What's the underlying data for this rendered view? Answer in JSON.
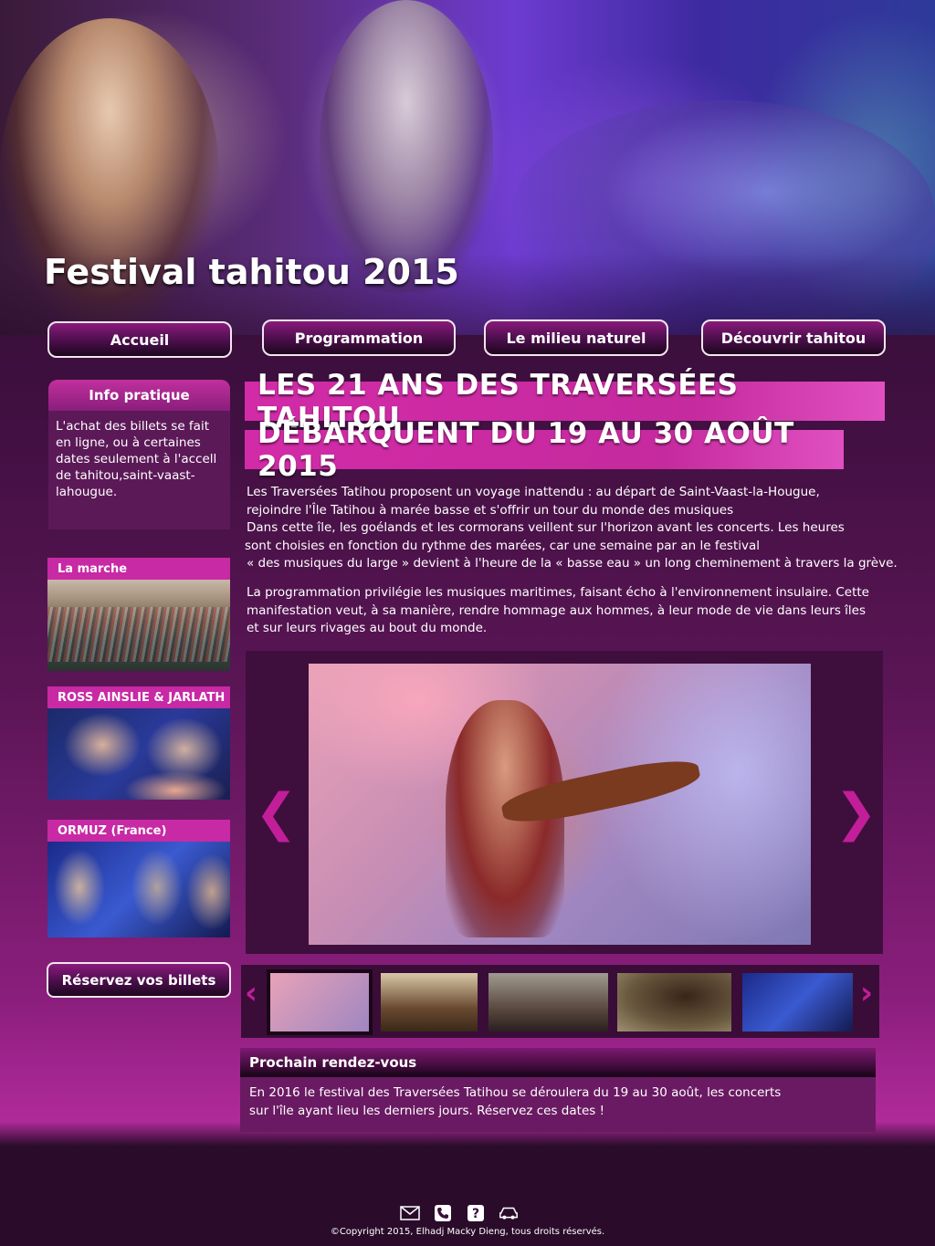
{
  "hero": {
    "title": "Festival tahitou 2015"
  },
  "nav": {
    "items": [
      {
        "label": "Accueil"
      },
      {
        "label": "Programmation"
      },
      {
        "label": "Le milieu naturel"
      },
      {
        "label": "Découvrir tahitou"
      }
    ]
  },
  "sidebar": {
    "info_title": "Info pratique",
    "info_text": "L'achat des billets se fait en ligne, ou à certaines dates seulement à l'accell de tahitou,saint-vaast-lahougue.",
    "cards": [
      {
        "caption": "La marche"
      },
      {
        "caption": "ROSS AINSLIE & JARLATH"
      },
      {
        "caption": "ORMUZ (France)"
      }
    ],
    "reserve_label": "Réservez vos billets"
  },
  "main": {
    "headline_1": "LES 21 ANS DES TRAVERSÉES TAHITOU",
    "headline_2": "DÉBARQUENT DU 19 AU 30 AOÛT 2015",
    "para_1_lines": [
      "Les Traversées Tatihou proposent un voyage inattendu : au départ de Saint-Vaast-la-Hougue,",
      " rejoindre l'Île Tatihou à marée basse et s'offrir un tour du monde des musiques",
      "Dans cette île, les goélands et les cormorans veillent sur l'horizon avant les concerts. Les heures",
      "sont choisies en fonction du rythme des marées, car une semaine par an le festival",
      "« des musiques du large » devient à  l'heure de la « basse eau » un long cheminement à travers la grève."
    ],
    "para_2_lines": [
      "La programmation privilégie les musiques maritimes, faisant écho à l'environnement insulaire. Cette",
      "manifestation veut, à sa manière, rendre hommage aux hommes, à leur mode de vie dans leurs îles",
      "et sur leurs rivages au bout du monde."
    ],
    "slider": {
      "prev": "❮",
      "next": "❯"
    },
    "thumbs": {
      "prev": "‹",
      "next": "›"
    },
    "next_event": {
      "title": "Prochain rendez-vous",
      "lines": [
        "En 2016 le festival des Traversées Tatihou se déroulera du 19 au 30 août, les concerts",
        "sur l'île ayant lieu les derniers jours. Réservez ces dates !"
      ]
    }
  },
  "footer": {
    "icons": [
      "mail-icon",
      "phone-icon",
      "help-icon",
      "car-icon"
    ],
    "copyright": "©Copyright 2015, Elhadj Macky Dieng, tous droits réservés."
  },
  "colors": {
    "accent": "#c829a4",
    "dark": "#3a0d38"
  }
}
